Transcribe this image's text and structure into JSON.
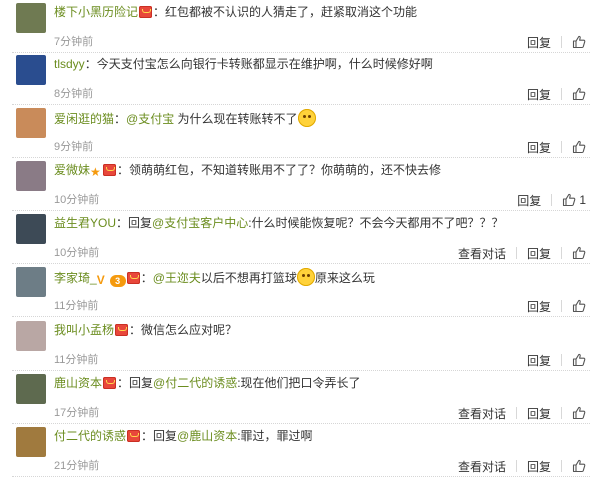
{
  "actions": {
    "reply": "回复",
    "view_conversation": "查看对话"
  },
  "comments": [
    {
      "user": "楼下小黑历险记",
      "badges": [
        "red-envelope-badge"
      ],
      "segments": [
        {
          "t": "text",
          "v": "：红包都被不认识的人猜走了，赶紧取消这个功能"
        }
      ],
      "time": "7分钟前",
      "show_conversation": false,
      "likes": ""
    },
    {
      "user": "tlsdyy",
      "badges": [],
      "segments": [
        {
          "t": "text",
          "v": "：今天支付宝怎么向银行卡转账都显示在维护啊，什么时候修好啊"
        }
      ],
      "time": "8分钟前",
      "show_conversation": false,
      "likes": ""
    },
    {
      "user": "爱闲逛的猫",
      "badges": [],
      "segments": [
        {
          "t": "text",
          "v": "："
        },
        {
          "t": "mention",
          "v": "@支付宝"
        },
        {
          "t": "text",
          "v": " 为什么现在转账转不了"
        },
        {
          "t": "emoji",
          "v": "shocked-face-emoji"
        }
      ],
      "time": "9分钟前",
      "show_conversation": false,
      "likes": ""
    },
    {
      "user": "爱微妹",
      "badges": [
        "vip-badge",
        "red-envelope-badge"
      ],
      "segments": [
        {
          "t": "text",
          "v": "：领萌萌红包，不知道转账用不了了？你萌萌的，还不快去修"
        }
      ],
      "time": "10分钟前",
      "show_conversation": false,
      "likes": "1"
    },
    {
      "user": "益生君YOU",
      "badges": [],
      "segments": [
        {
          "t": "text",
          "v": "：回复"
        },
        {
          "t": "mention",
          "v": "@支付宝客户中心"
        },
        {
          "t": "text",
          "v": ":什么时候能恢复呢？不会今天都用不了吧？？？"
        }
      ],
      "time": "10分钟前",
      "show_conversation": true,
      "likes": ""
    },
    {
      "user": "李家琦_",
      "badges": [
        "verified-v-badge",
        "level-badge",
        "red-envelope-badge"
      ],
      "level": "3",
      "segments": [
        {
          "t": "text",
          "v": "："
        },
        {
          "t": "mention",
          "v": "@王迩夫"
        },
        {
          "t": "text",
          "v": "以后不想再打篮球"
        },
        {
          "t": "emoji",
          "v": "laughing-face-emoji"
        },
        {
          "t": "text",
          "v": "原来这么玩"
        }
      ],
      "time": "11分钟前",
      "show_conversation": false,
      "likes": ""
    },
    {
      "user": "我叫小孟杨",
      "badges": [
        "red-envelope-badge"
      ],
      "segments": [
        {
          "t": "text",
          "v": "：微信怎么应对呢？"
        }
      ],
      "time": "11分钟前",
      "show_conversation": false,
      "likes": ""
    },
    {
      "user": "鹿山资本",
      "badges": [
        "red-envelope-badge"
      ],
      "segments": [
        {
          "t": "text",
          "v": "：回复"
        },
        {
          "t": "mention",
          "v": "@付二代的诱惑"
        },
        {
          "t": "text",
          "v": ":现在他们把口令弄长了"
        }
      ],
      "time": "17分钟前",
      "show_conversation": true,
      "likes": ""
    },
    {
      "user": "付二代的诱惑",
      "badges": [
        "red-envelope-badge"
      ],
      "segments": [
        {
          "t": "text",
          "v": "：回复"
        },
        {
          "t": "mention",
          "v": "@鹿山资本"
        },
        {
          "t": "text",
          "v": ":罪过，罪过啊"
        }
      ],
      "time": "21分钟前",
      "show_conversation": true,
      "likes": ""
    }
  ],
  "avatar_colors": [
    "#6f7a52",
    "#2a4d8f",
    "#c98b5a",
    "#8a7b86",
    "#3d4a56",
    "#6d7d86",
    "#b9a7a4",
    "#5e6a4f",
    "#a07a3e"
  ],
  "accent_color": "#6b8d1f"
}
